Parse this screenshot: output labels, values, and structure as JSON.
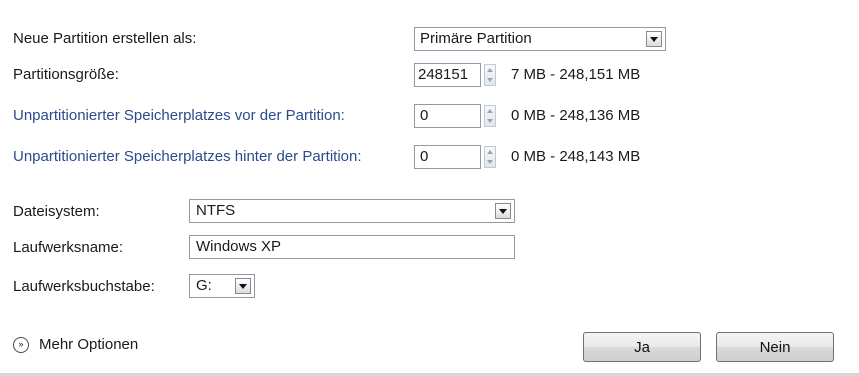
{
  "partition": {
    "type_label": "Neue Partition erstellen als:",
    "type_value": "Primäre Partition",
    "size_label": "Partitionsgröße:",
    "size_value": "248151",
    "size_range": "7 MB - 248,151 MB",
    "before_label": "Unpartitionierter Speicherplatzes vor der Partition:",
    "before_value": "0",
    "before_range": "0 MB - 248,136 MB",
    "after_label": "Unpartitionierter Speicherplatzes hinter der Partition:",
    "after_value": "0",
    "after_range": "0 MB - 248,143 MB"
  },
  "volume": {
    "fs_label": "Dateisystem:",
    "fs_value": "NTFS",
    "name_label": "Laufwerksname:",
    "name_value": "Windows XP",
    "letter_label": "Laufwerksbuchstabe:",
    "letter_value": "G:"
  },
  "footer": {
    "more_options": "Mehr Optionen",
    "yes_label": "Ja",
    "no_label": "Nein"
  },
  "icons": {
    "more_options": "chevron-double-down-icon",
    "dropdown": "chevron-down-icon",
    "spinner": "spin-arrows-icon"
  }
}
